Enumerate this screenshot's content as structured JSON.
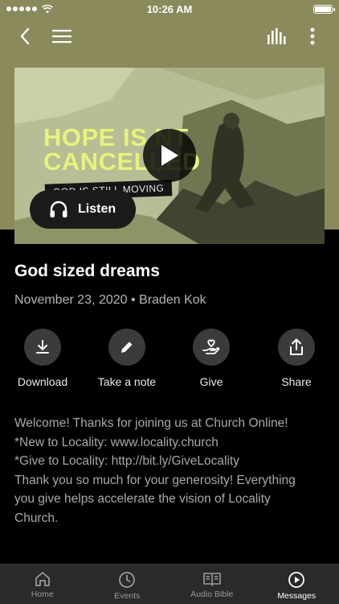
{
  "status_bar": {
    "time": "10:26 AM"
  },
  "hero": {
    "headline_line1": "HOPE IS NT",
    "headline_line2": "CANCELLED",
    "subline": "GOD IS STILL MOVING",
    "listen_label": "Listen"
  },
  "message": {
    "title": "God sized dreams",
    "meta": "November 23, 2020 • Braden Kok"
  },
  "actions": [
    {
      "label": "Download",
      "icon": "download-icon"
    },
    {
      "label": "Take a note",
      "icon": "pencil-icon"
    },
    {
      "label": "Give",
      "icon": "give-icon"
    },
    {
      "label": "Share",
      "icon": "share-icon"
    }
  ],
  "description": {
    "lines": [
      "Welcome! Thanks for joining us at Church Online!",
      "*New to Locality: www.locality.church",
      "*Give to Locality: http://bit.ly/GiveLocality",
      "Thank you so much for your generosity! Everything",
      "you give helps accelerate the vision of Locality",
      "Church."
    ]
  },
  "tabs": [
    {
      "label": "Home",
      "icon": "home-icon",
      "active": false
    },
    {
      "label": "Events",
      "icon": "clock-icon",
      "active": false
    },
    {
      "label": "Audio Bible",
      "icon": "book-icon",
      "active": false
    },
    {
      "label": "Messages",
      "icon": "play-circle-icon",
      "active": true
    }
  ],
  "colors": {
    "header_bg": "#8a8a5c",
    "headline": "#e9f27a",
    "tab_bar": "#2a2a2a"
  }
}
